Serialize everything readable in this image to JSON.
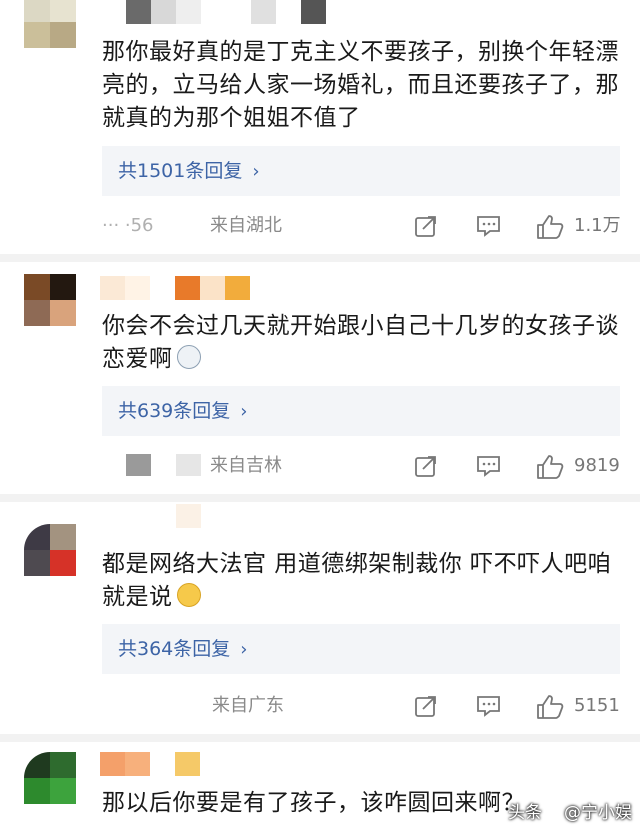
{
  "comments": [
    {
      "text": "那你最好真的是丁克主义不要孩子，别换个年轻漂亮的，立马给人家一场婚礼，而且还要孩子了，那就真的为那个姐姐不值了",
      "replies_label": "共1501条回复",
      "time": "··· ·56",
      "location": "来自湖北",
      "likes": "1.1万"
    },
    {
      "text": "你会不会过几天就开始跟小自己十几岁的女孩子谈恋爱啊",
      "replies_label": "共639条回复",
      "time": "",
      "location": "来自吉林",
      "likes": "9819"
    },
    {
      "text": "都是网络大法官 用道德绑架制裁你 吓不吓人吧咱就是说",
      "replies_label": "共364条回复",
      "time": "",
      "location": "来自广东",
      "likes": "5151"
    },
    {
      "text": "那以后你要是有了孩子，该咋圆回来啊？"
    }
  ],
  "icons": {
    "share": "share-icon",
    "comment": "comment-icon",
    "like": "like-icon",
    "chevron": "chevron-right-icon"
  },
  "watermark": {
    "brand": "头条",
    "author": "@宁小娱"
  },
  "colors": {
    "link": "#3d64a6",
    "reply_bg": "#f3f5f8",
    "meta": "#8a8a8a"
  }
}
